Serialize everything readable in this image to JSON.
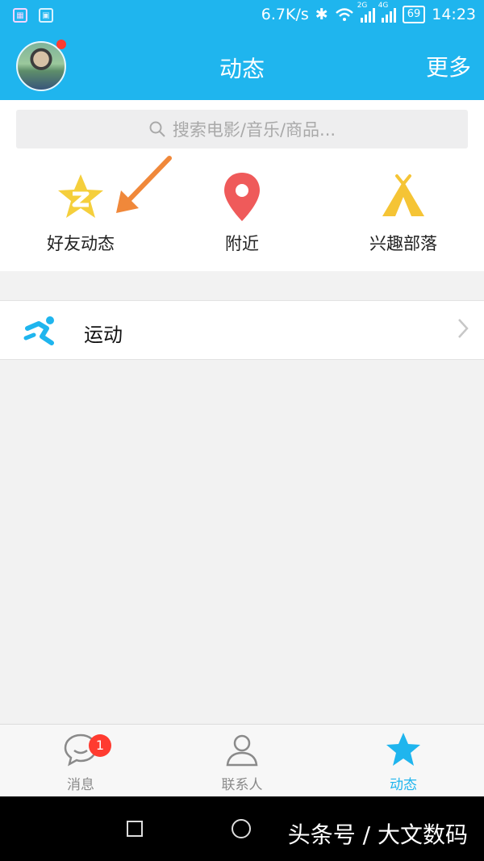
{
  "status_bar": {
    "net_speed": "6.7K/s",
    "sig1_label": "2G",
    "sig2_label": "4G",
    "battery": "69",
    "time": "14:23"
  },
  "header": {
    "title": "动态",
    "more": "更多"
  },
  "search": {
    "placeholder": "搜索电影/音乐/商品..."
  },
  "shortcuts": [
    {
      "label": "好友动态"
    },
    {
      "label": "附近"
    },
    {
      "label": "兴趣部落"
    }
  ],
  "list": [
    {
      "label": "运动"
    }
  ],
  "tabs": [
    {
      "label": "消息",
      "badge": "1"
    },
    {
      "label": "联系人"
    },
    {
      "label": "动态"
    }
  ],
  "watermark": "头条号 / 大文数码",
  "colors": {
    "accent": "#1fb5ee",
    "badge": "#ff3b30",
    "pin": "#ef5a5a",
    "star": "#f5cf3c",
    "arrow": "#f0883a"
  }
}
